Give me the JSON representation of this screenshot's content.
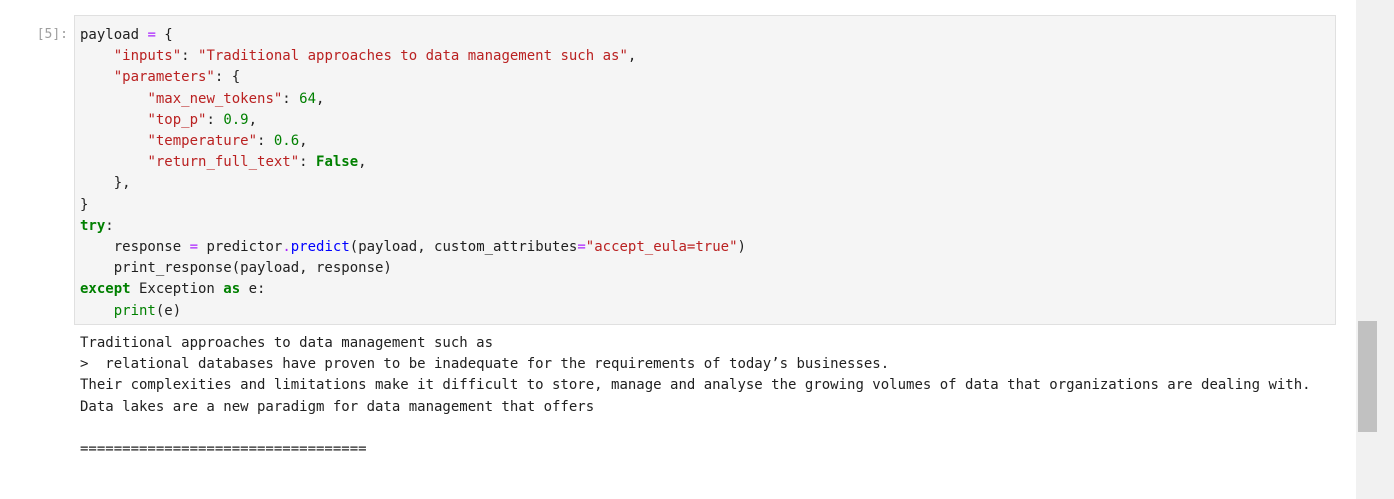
{
  "cell": {
    "prompt": "[5]:",
    "code_lines": [
      [
        {
          "t": "payload "
        },
        {
          "t": "=",
          "c": "o"
        },
        {
          "t": " {"
        }
      ],
      [
        {
          "t": "    "
        },
        {
          "t": "\"inputs\"",
          "c": "s"
        },
        {
          "t": ": "
        },
        {
          "t": "\"Traditional approaches to data management such as\"",
          "c": "s"
        },
        {
          "t": ","
        }
      ],
      [
        {
          "t": "    "
        },
        {
          "t": "\"parameters\"",
          "c": "s"
        },
        {
          "t": ": {"
        }
      ],
      [
        {
          "t": "        "
        },
        {
          "t": "\"max_new_tokens\"",
          "c": "s"
        },
        {
          "t": ": "
        },
        {
          "t": "64",
          "c": "n"
        },
        {
          "t": ","
        }
      ],
      [
        {
          "t": "        "
        },
        {
          "t": "\"top_p\"",
          "c": "s"
        },
        {
          "t": ": "
        },
        {
          "t": "0.9",
          "c": "n"
        },
        {
          "t": ","
        }
      ],
      [
        {
          "t": "        "
        },
        {
          "t": "\"temperature\"",
          "c": "s"
        },
        {
          "t": ": "
        },
        {
          "t": "0.6",
          "c": "n"
        },
        {
          "t": ","
        }
      ],
      [
        {
          "t": "        "
        },
        {
          "t": "\"return_full_text\"",
          "c": "s"
        },
        {
          "t": ": "
        },
        {
          "t": "False",
          "c": "k"
        },
        {
          "t": ","
        }
      ],
      [
        {
          "t": "    },"
        }
      ],
      [
        {
          "t": "}"
        }
      ],
      [
        {
          "t": "try",
          "c": "k"
        },
        {
          "t": ":"
        }
      ],
      [
        {
          "t": "    response "
        },
        {
          "t": "=",
          "c": "o"
        },
        {
          "t": " predictor"
        },
        {
          "t": ".",
          "c": "o"
        },
        {
          "t": "predict",
          "c": "f"
        },
        {
          "t": "(payload, custom_attributes"
        },
        {
          "t": "=",
          "c": "o"
        },
        {
          "t": "\"accept_eula=true\"",
          "c": "s"
        },
        {
          "t": ")"
        }
      ],
      [
        {
          "t": "    print_response(payload, response)"
        }
      ],
      [
        {
          "t": "except",
          "c": "k"
        },
        {
          "t": " Exception "
        },
        {
          "t": "as",
          "c": "k"
        },
        {
          "t": " e:"
        }
      ],
      [
        {
          "t": "    "
        },
        {
          "t": "print",
          "c": "b"
        },
        {
          "t": "(e)"
        }
      ]
    ]
  },
  "output": {
    "lines": [
      "Traditional approaches to data management such as",
      ">  relational databases have proven to be inadequate for the requirements of today’s businesses.",
      "Their complexities and limitations make it difficult to store, manage and analyse the growing volumes of data that organizations are dealing with.",
      "Data lakes are a new paradigm for data management that offers",
      "",
      "=================================="
    ]
  }
}
